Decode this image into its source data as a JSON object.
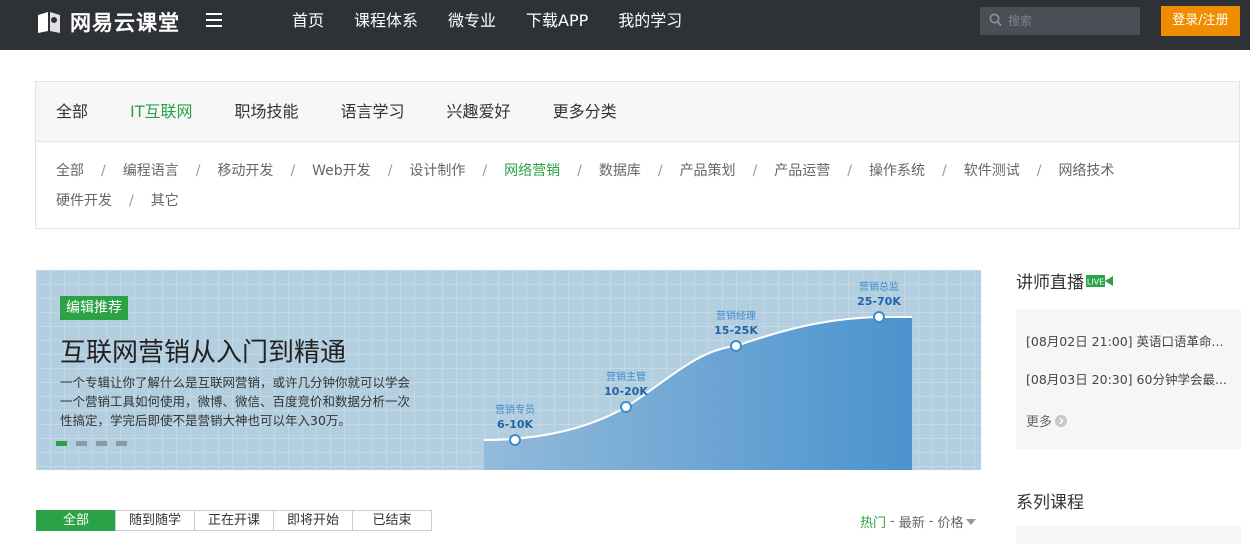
{
  "header": {
    "logo_text": "网易云课堂",
    "nav": [
      "首页",
      "课程体系",
      "微专业",
      "下载APP",
      "我的学习"
    ],
    "search_placeholder": "搜索",
    "login_label": "登录/注册"
  },
  "categories": {
    "main": [
      "全部",
      "IT互联网",
      "职场技能",
      "语言学习",
      "兴趣爱好",
      "更多分类"
    ],
    "main_active": "IT互联网",
    "sub": [
      "全部",
      "编程语言",
      "移动开发",
      "Web开发",
      "设计制作",
      "网络营销",
      "数据库",
      "产品策划",
      "产品运营",
      "操作系统",
      "软件测试",
      "网络技术",
      "硬件开发",
      "其它"
    ],
    "sub_active": "网络营销",
    "separator": "/"
  },
  "banner": {
    "tag": "编辑推荐",
    "title": "互联网营销从入门到精通",
    "description": "一个专辑让你了解什么是互联网营销，或许几分钟你就可以学会一个营销工具如何使用，微博、微信、百度竞价和数据分析一次性搞定，学完后即使不是营销大神也可以年入30万。",
    "slide_count": 4,
    "active_slide": 1,
    "career_points": [
      {
        "role": "营销专员",
        "salary": "6-10K"
      },
      {
        "role": "营销主管",
        "salary": "10-20K"
      },
      {
        "role": "营销经理",
        "salary": "15-25K"
      },
      {
        "role": "营销总监",
        "salary": "25-70K"
      }
    ]
  },
  "live": {
    "title": "讲师直播",
    "badge": "LIVE",
    "items": [
      "[08月02日 21:00] 英语口语革命...",
      "[08月03日 20:30] 60分钟学会最..."
    ],
    "more_label": "更多"
  },
  "series": {
    "title": "系列课程"
  },
  "filter_tabs": {
    "items": [
      "全部",
      "随到随学",
      "正在开课",
      "即将开始",
      "已结束"
    ],
    "active": "全部"
  },
  "sort": {
    "items": [
      "热门",
      "最新",
      "价格"
    ],
    "active": "热门",
    "separator": "-"
  },
  "colors": {
    "topbar": "#2e3136",
    "accent_green": "#2ba245",
    "login_orange": "#f08c00",
    "banner_bg": "#b3cfdf",
    "chart_blue": "#3f8ccc"
  }
}
